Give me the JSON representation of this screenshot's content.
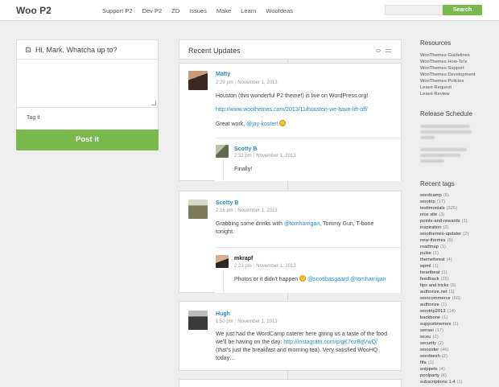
{
  "header": {
    "logo": "Woo P2",
    "nav": [
      "Support P2",
      "Dev P2",
      "ZD",
      "Issues",
      "Make",
      "Learn",
      "WooIdeas"
    ],
    "search_placeholder": "",
    "search_button": "Search"
  },
  "compose": {
    "prompt": "Hi, Mark. Whatcha up to?",
    "tag_placeholder": "Tag it",
    "post_button": "Post it"
  },
  "updates": {
    "title": "Recent Updates",
    "posts": [
      {
        "author": "Matty",
        "time": "2:29 pm",
        "date": "November 1, 2013",
        "line1": "Houston (this wonderful P2 theme!) is live on WordPress.org!",
        "link": "http://www.woothemes.com/2013/11/houston-we-have-lift-off/",
        "line3a": "Great work, ",
        "mention": "@jay-koster!",
        "reply": {
          "author": "Scotty B",
          "time": "2:32 pm",
          "date": "November 1, 2013",
          "text": "Finally!"
        }
      },
      {
        "author": "Scotty B",
        "time": "2:16 pm",
        "date": "November 1, 2013",
        "line1a": "Grabbing some drinks with ",
        "mention1": "@tomharrigan",
        "line1b": ", Tommy Gun, T-bone",
        "line2": "tonight.",
        "reply": {
          "author": "mkrapf",
          "time": "2:23 pm",
          "date": "November 1, 2013",
          "text": "Photos or it didn't happen ",
          "mention1": "@scottbasgaard",
          "mention2": "@tomharrigan"
        }
      },
      {
        "author": "Hugh",
        "time": "1:50 pm",
        "date": "November 1, 2013",
        "line1": "We just had the WordCamp caterer here giving us a taste of the food",
        "line2a": "we'll be having on the day: ",
        "link": "http://instagram.com/p/gK7ozBgVwQ/",
        "line3": "(that's just the breakfast and morning tea). Very satisfied WooHQ",
        "line4": "today…"
      }
    ]
  },
  "sidebar": {
    "resources_title": "Resources",
    "resources": [
      "WooThemes Guidelines",
      "WooThemes How-To's",
      "WooThemes Support",
      "WooThemes Development",
      "WooThemes Policies",
      "Leave Request",
      "Leave Review"
    ],
    "release_title": "Release Schedule",
    "tags_title": "Recent tags",
    "tags": [
      {
        "name": "wordcamp",
        "count": "(6)"
      },
      {
        "name": "wootrip",
        "count": "(17)"
      },
      {
        "name": "testimonials",
        "count": "(325)"
      },
      {
        "name": "nice site",
        "count": "(3)"
      },
      {
        "name": "points-and-rewards",
        "count": "(1)"
      },
      {
        "name": "inspiration",
        "count": "(2)"
      },
      {
        "name": "woothemes-updater",
        "count": "(2)"
      },
      {
        "name": "new-themes",
        "count": "(6)"
      },
      {
        "name": "roadmap",
        "count": "(1)"
      },
      {
        "name": "pulse",
        "count": "(1)"
      },
      {
        "name": "themeforest",
        "count": "(4)"
      },
      {
        "name": "wpml",
        "count": "(1)"
      },
      {
        "name": "heartbeat",
        "count": "(1)"
      },
      {
        "name": "feedback",
        "count": "(25)"
      },
      {
        "name": "tips and tricks",
        "count": "(5)"
      },
      {
        "name": "authorize.net",
        "count": "(1)"
      },
      {
        "name": "woocommerce",
        "count": "(66)"
      },
      {
        "name": "authorize",
        "count": "(1)"
      },
      {
        "name": "wootrip2013",
        "count": "(14)"
      },
      {
        "name": "backbone",
        "count": "(1)"
      },
      {
        "name": "supportmemes",
        "count": "(1)"
      },
      {
        "name": "sensei",
        "count": "(17)"
      },
      {
        "name": "wceu",
        "count": "(2)"
      },
      {
        "name": "security",
        "count": "(2)"
      },
      {
        "name": "woosider",
        "count": "(46)"
      },
      {
        "name": "wordsesh",
        "count": "(2)"
      },
      {
        "name": "fifa",
        "count": "(1)"
      },
      {
        "name": "snippets",
        "count": "(4)"
      },
      {
        "name": "poolparty",
        "count": "(6)"
      },
      {
        "name": "subscriptions 1.4",
        "count": "(1)"
      }
    ]
  }
}
